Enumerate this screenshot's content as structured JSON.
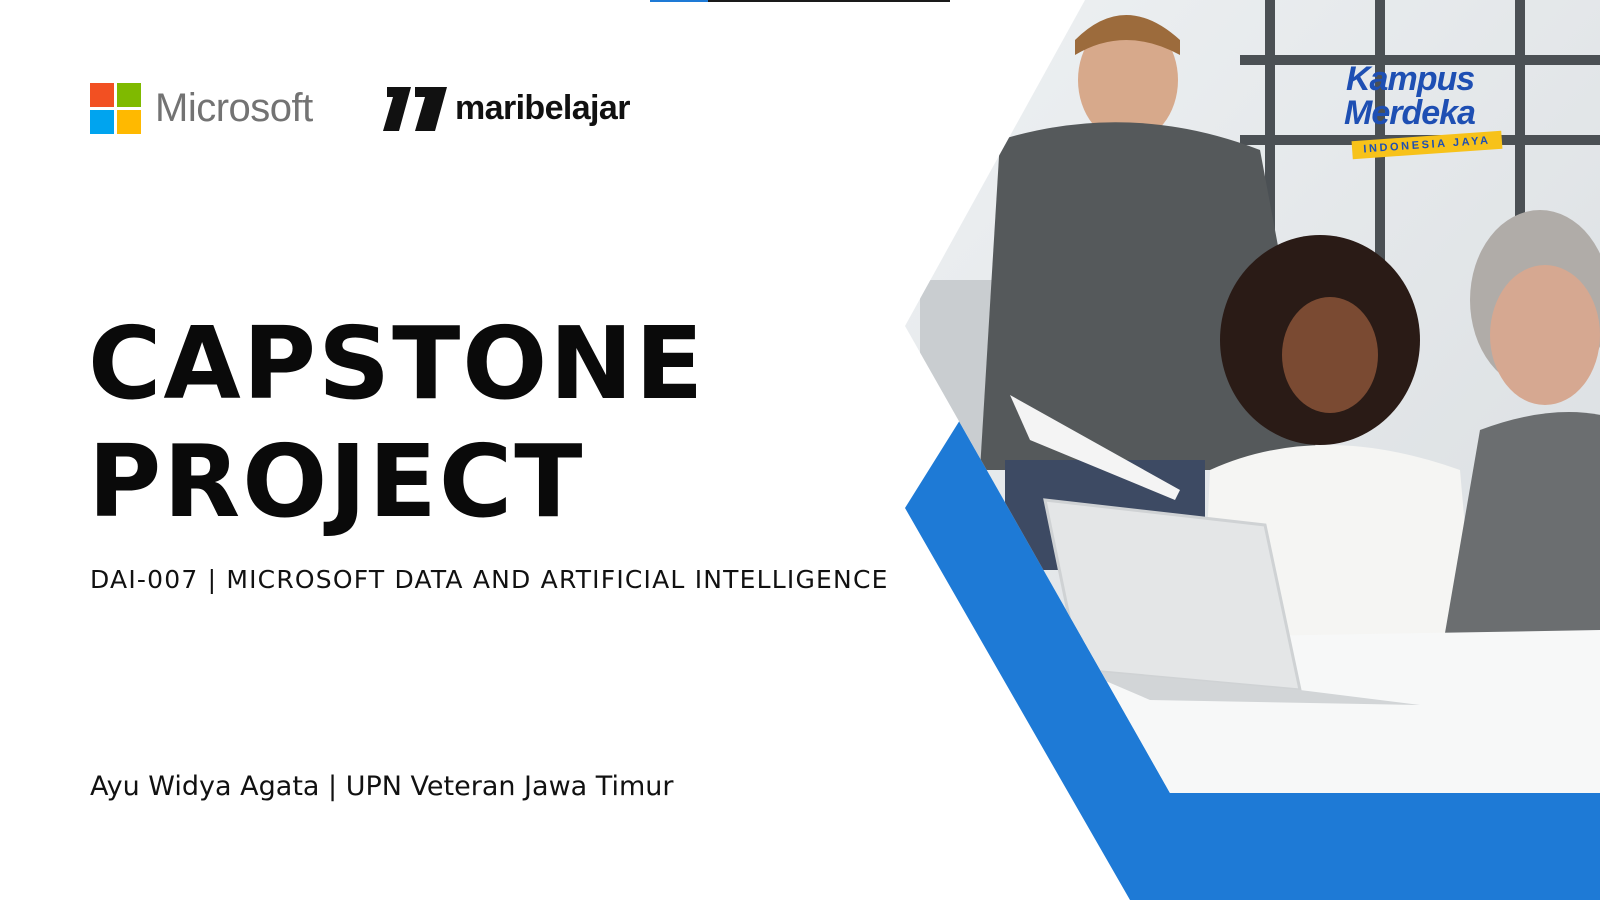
{
  "logos": {
    "microsoft": "Microsoft",
    "maribelajar": "maribelajar",
    "kampus_merdeka": {
      "line1": "Kampus",
      "line2": "Merdeka",
      "ribbon": "INDONESIA JAYA"
    }
  },
  "title": {
    "line1": "CAPSTONE",
    "line2": "PROJECT"
  },
  "subtitle": "DAI-007 | MICROSOFT DATA AND ARTIFICIAL INTELLIGENCE",
  "author": "Ayu Widya Agata | UPN Veteran Jawa Timur",
  "colors": {
    "accent_blue": "#1e7ad6",
    "ms_red": "#f25022",
    "ms_green": "#7fba00",
    "ms_blue": "#00a4ef",
    "ms_yellow": "#ffb900"
  }
}
